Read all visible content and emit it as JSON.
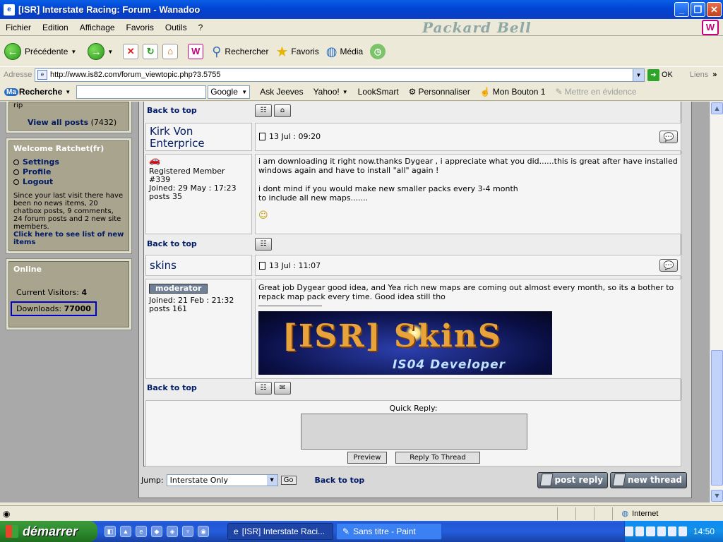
{
  "window": {
    "title": "[ISR] Interstate Racing: Forum - Wanadoo"
  },
  "menu": {
    "items": [
      "Fichier",
      "Edition",
      "Affichage",
      "Favoris",
      "Outils",
      "?"
    ],
    "brand": "Packard Bell"
  },
  "nav": {
    "back": "Précédente",
    "search": "Rechercher",
    "favorites": "Favoris",
    "media": "Média"
  },
  "address": {
    "label": "Adresse",
    "url": "http://www.is82.com/forum_viewtopic.php?3.5755",
    "go": "OK",
    "links": "Liens"
  },
  "searchbar": {
    "logo": "Recherche",
    "engine": "Google",
    "items": [
      "Ask Jeeves",
      "Yahoo!",
      "LookSmart",
      "Personnaliser",
      "Mon Bouton 1",
      "Mettre en évidence"
    ]
  },
  "sidebar": {
    "top_fragment": "rip",
    "view_all": "View all posts",
    "view_all_count": "(7432)",
    "welcome_title": "Welcome Ratchet(fr)",
    "links": [
      "Settings",
      "Profile",
      "Logout"
    ],
    "visit_text": "Since your last visit there have been no news items, 20 chatbox posts, 9 comments, 24 forum posts and 2 new site members.",
    "visit_link": "Click here to see list of new items",
    "online_title": "Online",
    "visitors_label": "Current Visitors:",
    "visitors_value": "4",
    "downloads_label": "Downloads:",
    "downloads_value": "77000"
  },
  "forum": {
    "back_to_top": "Back to top",
    "posts": [
      {
        "author": "Kirk Von Enterprice",
        "date": "13 Jul : 09:20",
        "rank": "Registered Member",
        "member_no": "#339",
        "joined": "Joined: 29 May : 17:23",
        "posts": "posts 35",
        "body1": "i am downloading it right now.thanks Dygear , i appreciate what you did......this is great after have installed windows again and have to install \"all\" again !",
        "body2": "i dont mind if you would make new smaller packs every 3-4 month",
        "body3": "to include all new maps.......",
        "smiley": "☺"
      },
      {
        "author": "skins",
        "date": "13 Jul : 11:07",
        "badge": "moderator",
        "joined": "Joined: 21 Feb : 21:32",
        "posts": "posts 161",
        "body1": "Great job Dygear good idea, and Yea rich new maps are coming out almost every month, so its a bother to repack map pack every time. Good idea still tho",
        "banner_title": "[ISR] SkinS",
        "banner_sub": "IS04 Developer"
      }
    ],
    "quick_reply": "Quick Reply:",
    "preview": "Preview",
    "reply_to_thread": "Reply To Thread",
    "jump_label": "Jump:",
    "jump_value": "Interstate Only",
    "go": "Go",
    "post_reply": "post reply",
    "new_thread": "new thread"
  },
  "status": {
    "zone": "Internet"
  },
  "taskbar": {
    "start": "démarrer",
    "task1": "[ISR] Interstate Raci...",
    "task2": "Sans titre - Paint",
    "clock": "14:50"
  }
}
